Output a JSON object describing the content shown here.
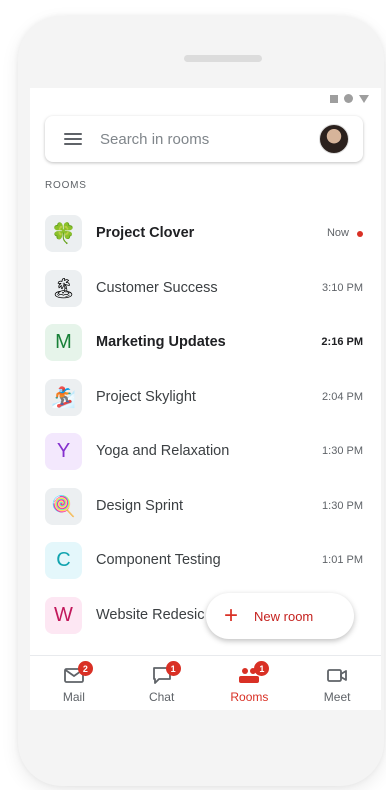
{
  "search": {
    "placeholder": "Search in rooms"
  },
  "section_label": "ROOMS",
  "rooms": [
    {
      "name": "Project Clover",
      "time": "Now",
      "bold": true,
      "unread": true,
      "icon": "clover-icon",
      "glyph": "🍀",
      "bg": "#eceff1"
    },
    {
      "name": "Customer Success",
      "time": "3:10 PM",
      "bold": false,
      "icon": "island-icon",
      "glyph": "🏝",
      "bg": "#eceff1"
    },
    {
      "name": "Marketing Updates",
      "time": "2:16 PM",
      "bold": true,
      "icon": "letter-m-avatar",
      "glyph": "M",
      "bg": "#e6f4ea",
      "fg": "#188038"
    },
    {
      "name": "Project Skylight",
      "time": "2:04 PM",
      "bold": false,
      "icon": "snowboarder-icon",
      "glyph": "🏂",
      "bg": "#eceff1"
    },
    {
      "name": "Yoga and Relaxation",
      "time": "1:30 PM",
      "bold": false,
      "icon": "letter-y-avatar",
      "glyph": "Y",
      "bg": "#f3e8fd",
      "fg": "#8430ce"
    },
    {
      "name": "Design Sprint",
      "time": "1:30 PM",
      "bold": false,
      "icon": "lollipop-icon",
      "glyph": "🍭",
      "bg": "#eceff1"
    },
    {
      "name": "Component Testing",
      "time": "1:01 PM",
      "bold": false,
      "icon": "letter-c-avatar",
      "glyph": "C",
      "bg": "#e4f7fb",
      "fg": "#12a4af"
    },
    {
      "name": "Website Redesic",
      "time": "",
      "bold": false,
      "icon": "letter-w-avatar",
      "glyph": "W",
      "bg": "#fde7f3",
      "fg": "#c2185b"
    }
  ],
  "fab": {
    "label": "New room"
  },
  "nav": [
    {
      "label": "Mail",
      "badge": "2",
      "icon": "mail-icon"
    },
    {
      "label": "Chat",
      "badge": "1",
      "icon": "chat-icon"
    },
    {
      "label": "Rooms",
      "badge": "1",
      "icon": "rooms-icon",
      "active": true
    },
    {
      "label": "Meet",
      "badge": "",
      "icon": "meet-icon"
    }
  ],
  "colors": {
    "accent": "#d93025"
  }
}
